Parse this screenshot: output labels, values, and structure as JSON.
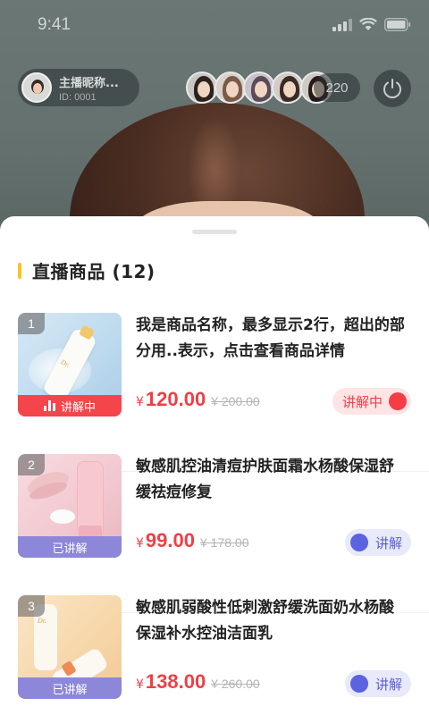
{
  "status_bar": {
    "time": "9:41"
  },
  "host": {
    "name": "主播昵称...",
    "id": "ID: 0001"
  },
  "viewer_count": "220",
  "sheet": {
    "title": "直播商品 (12)"
  },
  "currency_symbol": "¥",
  "products": [
    {
      "index": "1",
      "name": "我是商品名称，最多显示2行，超出的部分用..表示，点击查看商品详情",
      "price": "120.00",
      "old_price": "¥ 200.00",
      "status_label": "讲解中",
      "toggle_label": "讲解中",
      "toggle_on": true
    },
    {
      "index": "2",
      "name": "敏感肌控油清痘护肤面霜水杨酸保湿舒缓祛痘修复",
      "price": "99.00",
      "old_price": "¥ 178.00",
      "status_label": "已讲解",
      "toggle_label": "讲解",
      "toggle_on": false
    },
    {
      "index": "3",
      "name": "敏感肌弱酸性低刺激舒缓洗面奶水杨酸保湿补水控油洁面乳",
      "price": "138.00",
      "old_price": "¥ 260.00",
      "status_label": "已讲解",
      "toggle_label": "讲解",
      "toggle_on": false
    }
  ],
  "colors": {
    "accent_red": "#ef3f45",
    "accent_purple": "#5b63e0",
    "title_bar_yellow": "#f7c51e"
  },
  "icons": {
    "power": "power-icon",
    "signal": "signal-icon",
    "wifi": "wifi-icon",
    "battery": "battery-icon",
    "live_bars": "live-bars-icon"
  }
}
